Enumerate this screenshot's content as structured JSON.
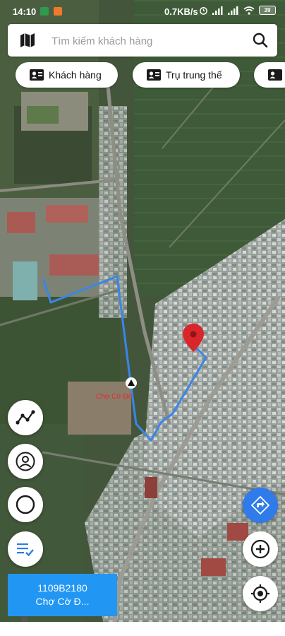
{
  "status_bar": {
    "time": "14:10",
    "network_speed": "0.7KB/s",
    "battery_level": "39",
    "icons": [
      "app-green-icon",
      "app-orange-icon",
      "alarm-icon",
      "signal-icon",
      "signal-icon",
      "wifi-icon",
      "battery-icon"
    ]
  },
  "search": {
    "placeholder": "Tìm kiếm khách hàng",
    "value": "",
    "icons": [
      "map-icon",
      "search-icon"
    ]
  },
  "chips": [
    {
      "label": "Khách hàng",
      "icon": "contact-card-icon"
    },
    {
      "label": "Trụ trung thế",
      "icon": "contact-card-icon"
    },
    {
      "label": "",
      "icon": "contact-card-icon"
    }
  ],
  "map": {
    "place_label": "Chợ Cờ Đỏ",
    "markers": [
      "destination-pin-icon",
      "start-marker-icon"
    ],
    "route_color": "#3a86e8",
    "pin_color": "#d9262b"
  },
  "left_controls": [
    "route-icon",
    "user-circle-icon",
    "circle-draw-icon",
    "checklist-icon"
  ],
  "right_controls": [
    "navigate-icon",
    "zoom-in-icon",
    "locate-icon"
  ],
  "info_card": {
    "code": "1109B2180",
    "name": "Chợ Cờ Đ..."
  },
  "colors": {
    "accent_blue": "#2196f3",
    "navigate_blue": "#2f7bea"
  }
}
